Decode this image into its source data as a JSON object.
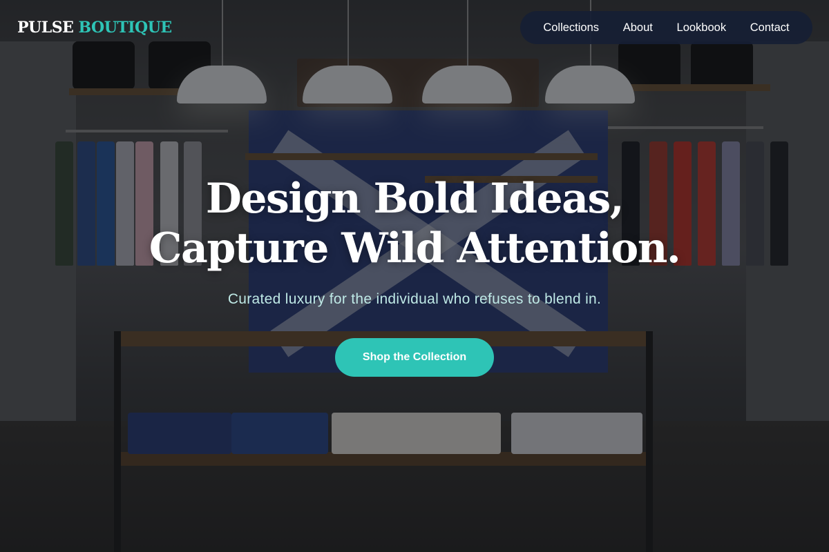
{
  "brand": {
    "name_primary": "PULSE",
    "name_accent": "BOUTIQUE",
    "accent_color": "#2ec4b6"
  },
  "nav": {
    "items": [
      {
        "label": "Collections"
      },
      {
        "label": "About"
      },
      {
        "label": "Lookbook"
      },
      {
        "label": "Contact"
      }
    ]
  },
  "hero": {
    "title_line1": "Design Bold Ideas,",
    "title_line2": "Capture Wild Attention.",
    "subtitle": "Curated luxury for the individual who refuses to blend in.",
    "cta_label": "Shop the Collection"
  },
  "colors": {
    "nav_background": "#161e34",
    "cta_background": "#2ec4b6",
    "subtitle_color": "#bfe9e6"
  }
}
